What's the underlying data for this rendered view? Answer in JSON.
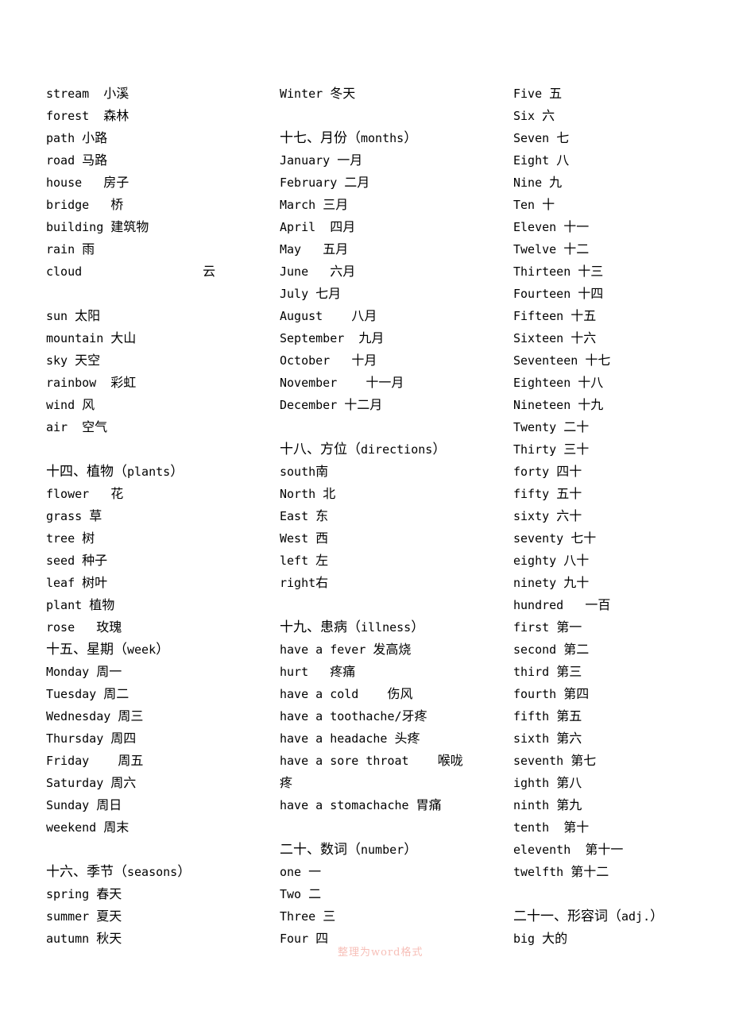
{
  "document": {
    "title": "English-Chinese Vocabulary List",
    "watermark": "整理为word格式",
    "watermark_color": "#f7bfb8",
    "text_color": "#000000",
    "background_color": "#ffffff"
  },
  "columns": [
    {
      "id": "column-1",
      "lines": [
        {
          "type": "entry",
          "en": "stream",
          "gap": "  ",
          "cn": "小溪"
        },
        {
          "type": "entry",
          "en": "forest",
          "gap": "  ",
          "cn": "森林"
        },
        {
          "type": "entry",
          "en": "path",
          "gap": " ",
          "cn": "小路"
        },
        {
          "type": "entry",
          "en": "road",
          "gap": " ",
          "cn": "马路"
        },
        {
          "type": "entry",
          "en": "house",
          "gap": "   ",
          "cn": "房子"
        },
        {
          "type": "entry",
          "en": "bridge",
          "gap": "   ",
          "cn": "桥"
        },
        {
          "type": "entry",
          "en": "building",
          "gap": " ",
          "cn": "建筑物"
        },
        {
          "type": "entry",
          "en": "rain",
          "gap": " ",
          "cn": "雨"
        },
        {
          "type": "entry-far",
          "en": "cloud",
          "cn": "云"
        },
        {
          "type": "blank"
        },
        {
          "type": "entry",
          "en": "sun",
          "gap": " ",
          "cn": "太阳"
        },
        {
          "type": "entry",
          "en": "mountain",
          "gap": " ",
          "cn": "大山"
        },
        {
          "type": "entry",
          "en": "sky",
          "gap": " ",
          "cn": "天空"
        },
        {
          "type": "entry",
          "en": "rainbow",
          "gap": "  ",
          "cn": "彩虹"
        },
        {
          "type": "entry",
          "en": "wind",
          "gap": " ",
          "cn": "风"
        },
        {
          "type": "entry",
          "en": "air",
          "gap": "  ",
          "cn": "空气"
        },
        {
          "type": "blank"
        },
        {
          "type": "heading",
          "cn_pre": "十四、植物（",
          "en": "plants",
          "cn_post": "）"
        },
        {
          "type": "entry",
          "en": "flower",
          "gap": "   ",
          "cn": "花"
        },
        {
          "type": "entry",
          "en": "grass",
          "gap": " ",
          "cn": "草"
        },
        {
          "type": "entry",
          "en": "tree",
          "gap": " ",
          "cn": "树"
        },
        {
          "type": "entry",
          "en": "seed",
          "gap": " ",
          "cn": "种子"
        },
        {
          "type": "entry",
          "en": "leaf",
          "gap": " ",
          "cn": "树叶"
        },
        {
          "type": "entry",
          "en": "plant",
          "gap": " ",
          "cn": "植物"
        },
        {
          "type": "entry",
          "en": "rose",
          "gap": "   ",
          "cn": "玫瑰"
        },
        {
          "type": "heading",
          "cn_pre": "十五、星期（",
          "en": "week",
          "cn_post": "）"
        },
        {
          "type": "entry",
          "en": "Monday",
          "gap": " ",
          "cn": "周一"
        },
        {
          "type": "entry",
          "en": "Tuesday",
          "gap": " ",
          "cn": "周二"
        },
        {
          "type": "entry",
          "en": "Wednesday",
          "gap": " ",
          "cn": "周三"
        },
        {
          "type": "entry",
          "en": "Thursday",
          "gap": " ",
          "cn": "周四"
        },
        {
          "type": "entry",
          "en": "Friday",
          "gap": "    ",
          "cn": "周五"
        },
        {
          "type": "entry",
          "en": "Saturday",
          "gap": " ",
          "cn": "周六"
        },
        {
          "type": "entry",
          "en": "Sunday",
          "gap": " ",
          "cn": "周日"
        },
        {
          "type": "entry",
          "en": "weekend",
          "gap": " ",
          "cn": "周末"
        },
        {
          "type": "blank"
        },
        {
          "type": "heading",
          "cn_pre": "十六、季节（",
          "en": "seasons",
          "cn_post": "）"
        },
        {
          "type": "entry",
          "en": "spring",
          "gap": " ",
          "cn": "春天"
        },
        {
          "type": "entry",
          "en": "summer",
          "gap": " ",
          "cn": "夏天"
        },
        {
          "type": "entry",
          "en": "autumn",
          "gap": " ",
          "cn": "秋天"
        }
      ]
    },
    {
      "id": "column-2",
      "lines": [
        {
          "type": "entry",
          "en": "Winter",
          "gap": " ",
          "cn": "冬天"
        },
        {
          "type": "blank"
        },
        {
          "type": "heading",
          "cn_pre": "十七、月份（",
          "en": "months",
          "cn_post": "）"
        },
        {
          "type": "entry",
          "en": "January",
          "gap": " ",
          "cn": "一月"
        },
        {
          "type": "entry",
          "en": "February",
          "gap": " ",
          "cn": "二月"
        },
        {
          "type": "entry",
          "en": "March",
          "gap": " ",
          "cn": "三月"
        },
        {
          "type": "entry",
          "en": "April",
          "gap": "  ",
          "cn": "四月"
        },
        {
          "type": "entry",
          "en": "May",
          "gap": "   ",
          "cn": "五月"
        },
        {
          "type": "entry",
          "en": "June",
          "gap": "   ",
          "cn": "六月"
        },
        {
          "type": "entry",
          "en": "July",
          "gap": " ",
          "cn": "七月"
        },
        {
          "type": "entry",
          "en": "August",
          "gap": "    ",
          "cn": "八月"
        },
        {
          "type": "entry",
          "en": "September",
          "gap": "  ",
          "cn": "九月"
        },
        {
          "type": "entry",
          "en": "October",
          "gap": "   ",
          "cn": "十月"
        },
        {
          "type": "entry",
          "en": "November",
          "gap": "    ",
          "cn": "十一月"
        },
        {
          "type": "entry",
          "en": "December",
          "gap": " ",
          "cn": "十二月"
        },
        {
          "type": "blank"
        },
        {
          "type": "heading",
          "cn_pre": "十八、方位（",
          "en": "directions",
          "cn_post": "）"
        },
        {
          "type": "entry",
          "en": "south",
          "gap": "",
          "cn": "南"
        },
        {
          "type": "entry",
          "en": "North",
          "gap": " ",
          "cn": "北"
        },
        {
          "type": "entry",
          "en": "East",
          "gap": " ",
          "cn": "东"
        },
        {
          "type": "entry",
          "en": "West",
          "gap": " ",
          "cn": "西"
        },
        {
          "type": "entry",
          "en": "left",
          "gap": " ",
          "cn": "左"
        },
        {
          "type": "entry",
          "en": "right",
          "gap": "",
          "cn": "右"
        },
        {
          "type": "blank"
        },
        {
          "type": "heading",
          "cn_pre": "十九、患病（",
          "en": "illness",
          "cn_post": "）"
        },
        {
          "type": "entry",
          "en": "have a fever",
          "gap": " ",
          "cn": "发高烧"
        },
        {
          "type": "entry",
          "en": "hurt",
          "gap": "   ",
          "cn": "疼痛"
        },
        {
          "type": "entry",
          "en": "have a cold",
          "gap": "    ",
          "cn": "伤风"
        },
        {
          "type": "entry",
          "en": "have a toothache/",
          "gap": "",
          "cn": "牙疼"
        },
        {
          "type": "entry",
          "en": "have a headache",
          "gap": " ",
          "cn": "头疼"
        },
        {
          "type": "entry",
          "en": "have a sore throat",
          "gap": "    ",
          "cn": "喉咙"
        },
        {
          "type": "cn-only",
          "cn": "疼"
        },
        {
          "type": "entry",
          "en": "have a stomachache",
          "gap": " ",
          "cn": "胃痛"
        },
        {
          "type": "blank"
        },
        {
          "type": "heading",
          "cn_pre": "二十、数词（",
          "en": "number",
          "cn_post": "）"
        },
        {
          "type": "entry",
          "en": "one",
          "gap": " ",
          "cn": "一"
        },
        {
          "type": "entry",
          "en": "Two",
          "gap": " ",
          "cn": "二"
        },
        {
          "type": "entry",
          "en": "Three",
          "gap": " ",
          "cn": "三"
        },
        {
          "type": "entry",
          "en": "Four",
          "gap": " ",
          "cn": "四"
        }
      ]
    },
    {
      "id": "column-3",
      "lines": [
        {
          "type": "entry",
          "en": "Five",
          "gap": " ",
          "cn": "五"
        },
        {
          "type": "entry",
          "en": "Six",
          "gap": " ",
          "cn": "六"
        },
        {
          "type": "entry",
          "en": "Seven",
          "gap": " ",
          "cn": "七"
        },
        {
          "type": "entry",
          "en": "Eight",
          "gap": " ",
          "cn": "八"
        },
        {
          "type": "entry",
          "en": "Nine",
          "gap": " ",
          "cn": "九"
        },
        {
          "type": "entry",
          "en": "Ten",
          "gap": " ",
          "cn": "十"
        },
        {
          "type": "entry",
          "en": "Eleven",
          "gap": " ",
          "cn": "十一"
        },
        {
          "type": "entry",
          "en": "Twelve",
          "gap": " ",
          "cn": "十二"
        },
        {
          "type": "entry",
          "en": "Thirteen",
          "gap": " ",
          "cn": "十三"
        },
        {
          "type": "entry",
          "en": "Fourteen",
          "gap": " ",
          "cn": "十四"
        },
        {
          "type": "entry",
          "en": "Fifteen",
          "gap": " ",
          "cn": "十五"
        },
        {
          "type": "entry",
          "en": "Sixteen",
          "gap": " ",
          "cn": "十六"
        },
        {
          "type": "entry",
          "en": "Seventeen",
          "gap": " ",
          "cn": "十七"
        },
        {
          "type": "entry",
          "en": "Eighteen",
          "gap": " ",
          "cn": "十八"
        },
        {
          "type": "entry",
          "en": "Nineteen",
          "gap": " ",
          "cn": "十九"
        },
        {
          "type": "entry",
          "en": "Twenty",
          "gap": " ",
          "cn": "二十"
        },
        {
          "type": "entry",
          "en": "Thirty",
          "gap": " ",
          "cn": "三十"
        },
        {
          "type": "entry",
          "en": "forty",
          "gap": " ",
          "cn": "四十"
        },
        {
          "type": "entry",
          "en": "fifty",
          "gap": " ",
          "cn": "五十"
        },
        {
          "type": "entry",
          "en": "sixty",
          "gap": " ",
          "cn": "六十"
        },
        {
          "type": "entry",
          "en": "seventy",
          "gap": " ",
          "cn": "七十"
        },
        {
          "type": "entry",
          "en": "eighty",
          "gap": " ",
          "cn": "八十"
        },
        {
          "type": "entry",
          "en": "ninety",
          "gap": " ",
          "cn": "九十"
        },
        {
          "type": "entry",
          "en": "hundred",
          "gap": "   ",
          "cn": "一百"
        },
        {
          "type": "entry",
          "en": "first",
          "gap": " ",
          "cn": "第一"
        },
        {
          "type": "entry",
          "en": "second",
          "gap": " ",
          "cn": "第二"
        },
        {
          "type": "entry",
          "en": "third",
          "gap": " ",
          "cn": "第三"
        },
        {
          "type": "entry",
          "en": "fourth",
          "gap": " ",
          "cn": "第四"
        },
        {
          "type": "entry",
          "en": "fifth",
          "gap": " ",
          "cn": "第五"
        },
        {
          "type": "entry",
          "en": "sixth",
          "gap": " ",
          "cn": "第六"
        },
        {
          "type": "entry",
          "en": "seventh",
          "gap": " ",
          "cn": "第七"
        },
        {
          "type": "entry",
          "en": "ighth",
          "gap": " ",
          "cn": "第八"
        },
        {
          "type": "entry",
          "en": "ninth",
          "gap": " ",
          "cn": "第九"
        },
        {
          "type": "entry",
          "en": "tenth",
          "gap": "  ",
          "cn": "第十"
        },
        {
          "type": "entry",
          "en": "eleventh",
          "gap": "  ",
          "cn": "第十一"
        },
        {
          "type": "entry",
          "en": "twelfth",
          "gap": " ",
          "cn": "第十二"
        },
        {
          "type": "blank"
        },
        {
          "type": "heading",
          "cn_pre": "二十一、形容词（",
          "en": "adj.",
          "cn_post": "）"
        },
        {
          "type": "entry",
          "en": "big",
          "gap": " ",
          "cn": "大的"
        }
      ]
    }
  ]
}
